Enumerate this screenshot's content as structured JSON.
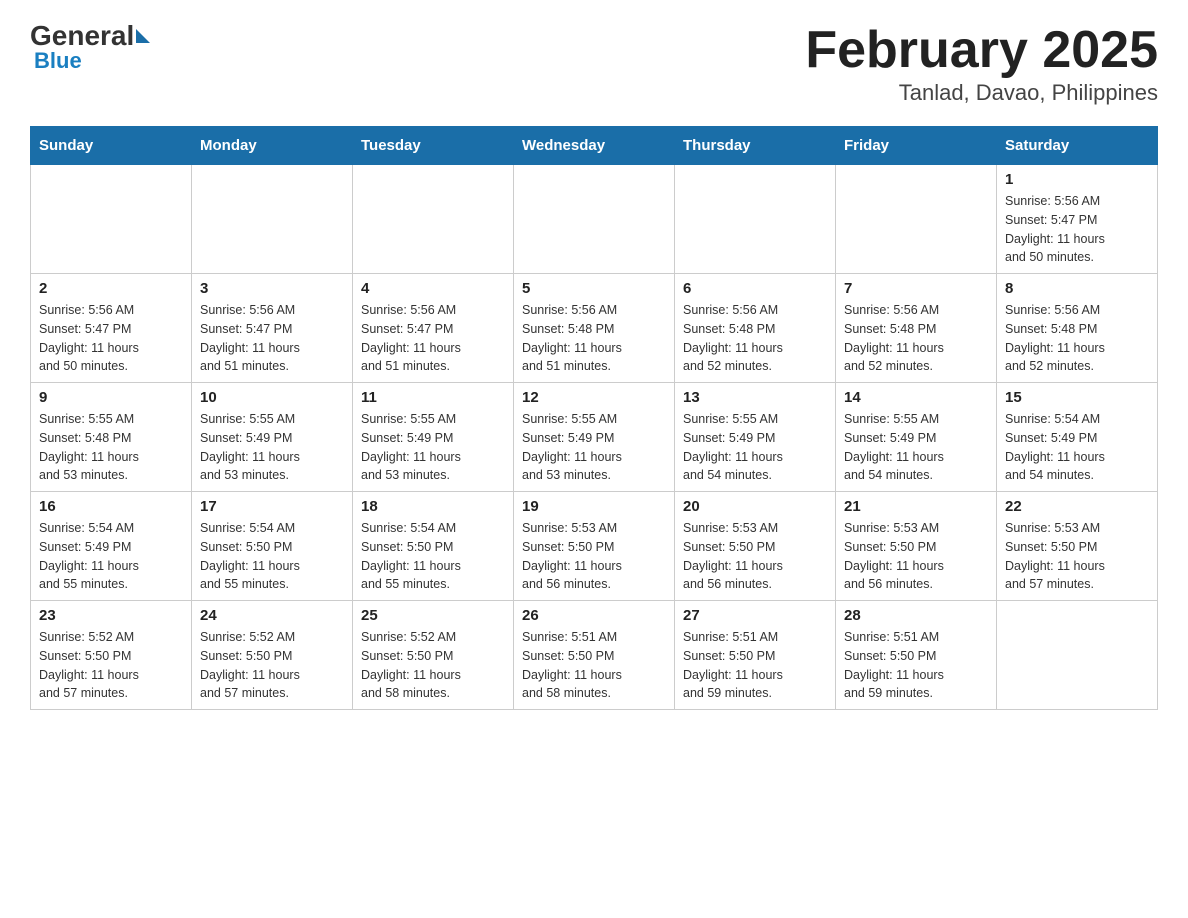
{
  "logo": {
    "general": "General",
    "blue": "Blue"
  },
  "title": "February 2025",
  "location": "Tanlad, Davao, Philippines",
  "weekdays": [
    "Sunday",
    "Monday",
    "Tuesday",
    "Wednesday",
    "Thursday",
    "Friday",
    "Saturday"
  ],
  "weeks": [
    [
      {
        "day": "",
        "info": ""
      },
      {
        "day": "",
        "info": ""
      },
      {
        "day": "",
        "info": ""
      },
      {
        "day": "",
        "info": ""
      },
      {
        "day": "",
        "info": ""
      },
      {
        "day": "",
        "info": ""
      },
      {
        "day": "1",
        "info": "Sunrise: 5:56 AM\nSunset: 5:47 PM\nDaylight: 11 hours\nand 50 minutes."
      }
    ],
    [
      {
        "day": "2",
        "info": "Sunrise: 5:56 AM\nSunset: 5:47 PM\nDaylight: 11 hours\nand 50 minutes."
      },
      {
        "day": "3",
        "info": "Sunrise: 5:56 AM\nSunset: 5:47 PM\nDaylight: 11 hours\nand 51 minutes."
      },
      {
        "day": "4",
        "info": "Sunrise: 5:56 AM\nSunset: 5:47 PM\nDaylight: 11 hours\nand 51 minutes."
      },
      {
        "day": "5",
        "info": "Sunrise: 5:56 AM\nSunset: 5:48 PM\nDaylight: 11 hours\nand 51 minutes."
      },
      {
        "day": "6",
        "info": "Sunrise: 5:56 AM\nSunset: 5:48 PM\nDaylight: 11 hours\nand 52 minutes."
      },
      {
        "day": "7",
        "info": "Sunrise: 5:56 AM\nSunset: 5:48 PM\nDaylight: 11 hours\nand 52 minutes."
      },
      {
        "day": "8",
        "info": "Sunrise: 5:56 AM\nSunset: 5:48 PM\nDaylight: 11 hours\nand 52 minutes."
      }
    ],
    [
      {
        "day": "9",
        "info": "Sunrise: 5:55 AM\nSunset: 5:48 PM\nDaylight: 11 hours\nand 53 minutes."
      },
      {
        "day": "10",
        "info": "Sunrise: 5:55 AM\nSunset: 5:49 PM\nDaylight: 11 hours\nand 53 minutes."
      },
      {
        "day": "11",
        "info": "Sunrise: 5:55 AM\nSunset: 5:49 PM\nDaylight: 11 hours\nand 53 minutes."
      },
      {
        "day": "12",
        "info": "Sunrise: 5:55 AM\nSunset: 5:49 PM\nDaylight: 11 hours\nand 53 minutes."
      },
      {
        "day": "13",
        "info": "Sunrise: 5:55 AM\nSunset: 5:49 PM\nDaylight: 11 hours\nand 54 minutes."
      },
      {
        "day": "14",
        "info": "Sunrise: 5:55 AM\nSunset: 5:49 PM\nDaylight: 11 hours\nand 54 minutes."
      },
      {
        "day": "15",
        "info": "Sunrise: 5:54 AM\nSunset: 5:49 PM\nDaylight: 11 hours\nand 54 minutes."
      }
    ],
    [
      {
        "day": "16",
        "info": "Sunrise: 5:54 AM\nSunset: 5:49 PM\nDaylight: 11 hours\nand 55 minutes."
      },
      {
        "day": "17",
        "info": "Sunrise: 5:54 AM\nSunset: 5:50 PM\nDaylight: 11 hours\nand 55 minutes."
      },
      {
        "day": "18",
        "info": "Sunrise: 5:54 AM\nSunset: 5:50 PM\nDaylight: 11 hours\nand 55 minutes."
      },
      {
        "day": "19",
        "info": "Sunrise: 5:53 AM\nSunset: 5:50 PM\nDaylight: 11 hours\nand 56 minutes."
      },
      {
        "day": "20",
        "info": "Sunrise: 5:53 AM\nSunset: 5:50 PM\nDaylight: 11 hours\nand 56 minutes."
      },
      {
        "day": "21",
        "info": "Sunrise: 5:53 AM\nSunset: 5:50 PM\nDaylight: 11 hours\nand 56 minutes."
      },
      {
        "day": "22",
        "info": "Sunrise: 5:53 AM\nSunset: 5:50 PM\nDaylight: 11 hours\nand 57 minutes."
      }
    ],
    [
      {
        "day": "23",
        "info": "Sunrise: 5:52 AM\nSunset: 5:50 PM\nDaylight: 11 hours\nand 57 minutes."
      },
      {
        "day": "24",
        "info": "Sunrise: 5:52 AM\nSunset: 5:50 PM\nDaylight: 11 hours\nand 57 minutes."
      },
      {
        "day": "25",
        "info": "Sunrise: 5:52 AM\nSunset: 5:50 PM\nDaylight: 11 hours\nand 58 minutes."
      },
      {
        "day": "26",
        "info": "Sunrise: 5:51 AM\nSunset: 5:50 PM\nDaylight: 11 hours\nand 58 minutes."
      },
      {
        "day": "27",
        "info": "Sunrise: 5:51 AM\nSunset: 5:50 PM\nDaylight: 11 hours\nand 59 minutes."
      },
      {
        "day": "28",
        "info": "Sunrise: 5:51 AM\nSunset: 5:50 PM\nDaylight: 11 hours\nand 59 minutes."
      },
      {
        "day": "",
        "info": ""
      }
    ]
  ]
}
